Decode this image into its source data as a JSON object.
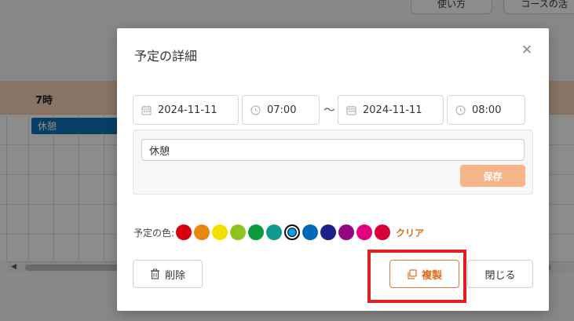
{
  "background": {
    "top_buttons": [
      "使い方",
      "コースの活"
    ],
    "grid_hour": "7時",
    "event_label": "休憩"
  },
  "modal": {
    "title": "予定の詳細",
    "start_date": "2024-11-11",
    "start_time": "07:00",
    "separator": "～",
    "end_date": "2024-11-11",
    "end_time": "08:00",
    "memo_value": "休憩",
    "save_label": "保存",
    "color_label": "予定の色:",
    "colors": [
      "#d7000f",
      "#e8870e",
      "#f4e103",
      "#8fc31f",
      "#0b9a3c",
      "#109a8f",
      "#00a0e9",
      "#0068b7",
      "#1d2088",
      "#920783",
      "#e4007f",
      "#d7003a"
    ],
    "selected_color_index": 6,
    "clear_label": "クリア",
    "delete_label": "削除",
    "duplicate_label": "複製",
    "close_label": "閉じる"
  }
}
